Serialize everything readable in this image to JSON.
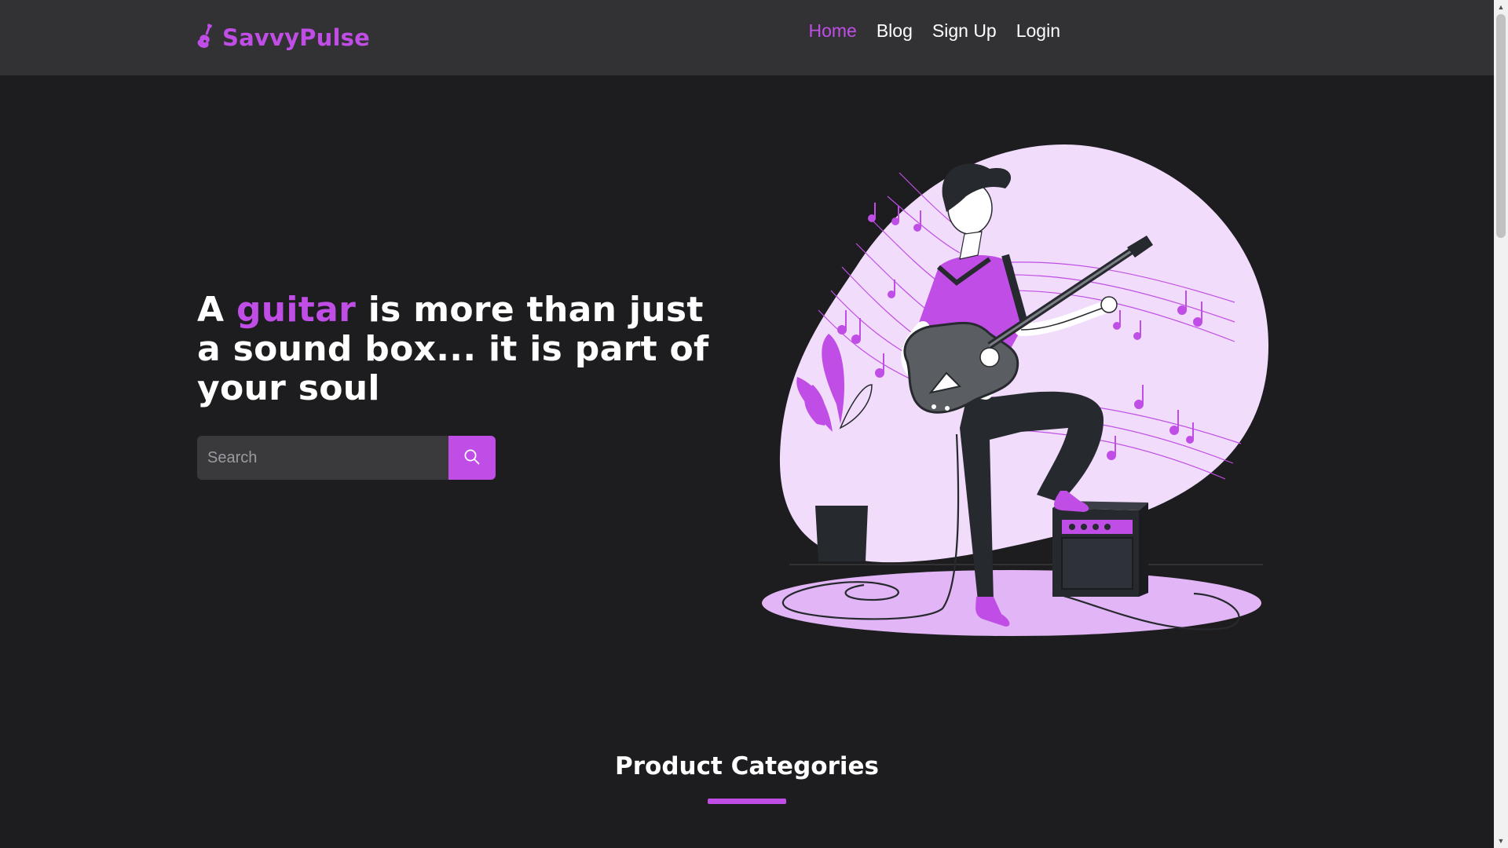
{
  "brand": {
    "name": "SavvyPulse",
    "icon": "guitar-icon",
    "color": "#c04ee6"
  },
  "nav": {
    "items": [
      {
        "label": "Home",
        "active": true
      },
      {
        "label": "Blog",
        "active": false
      },
      {
        "label": "Sign Up",
        "active": false
      },
      {
        "label": "Login",
        "active": false
      }
    ]
  },
  "hero": {
    "title_prefix": "A ",
    "title_highlight": "guitar",
    "title_suffix": " is more than just a sound box... it is part of your soul",
    "search": {
      "placeholder": "Search",
      "value": "",
      "icon": "search-icon"
    },
    "illustration": "guitarist-with-amplifier-illustration"
  },
  "sections": {
    "product_categories_title": "Product Categories"
  },
  "colors": {
    "accent": "#c04ee6",
    "navbar_bg": "#323235",
    "page_bg": "#1d1c1f",
    "blob": "#f1ddfb",
    "dark": "#26292d"
  }
}
